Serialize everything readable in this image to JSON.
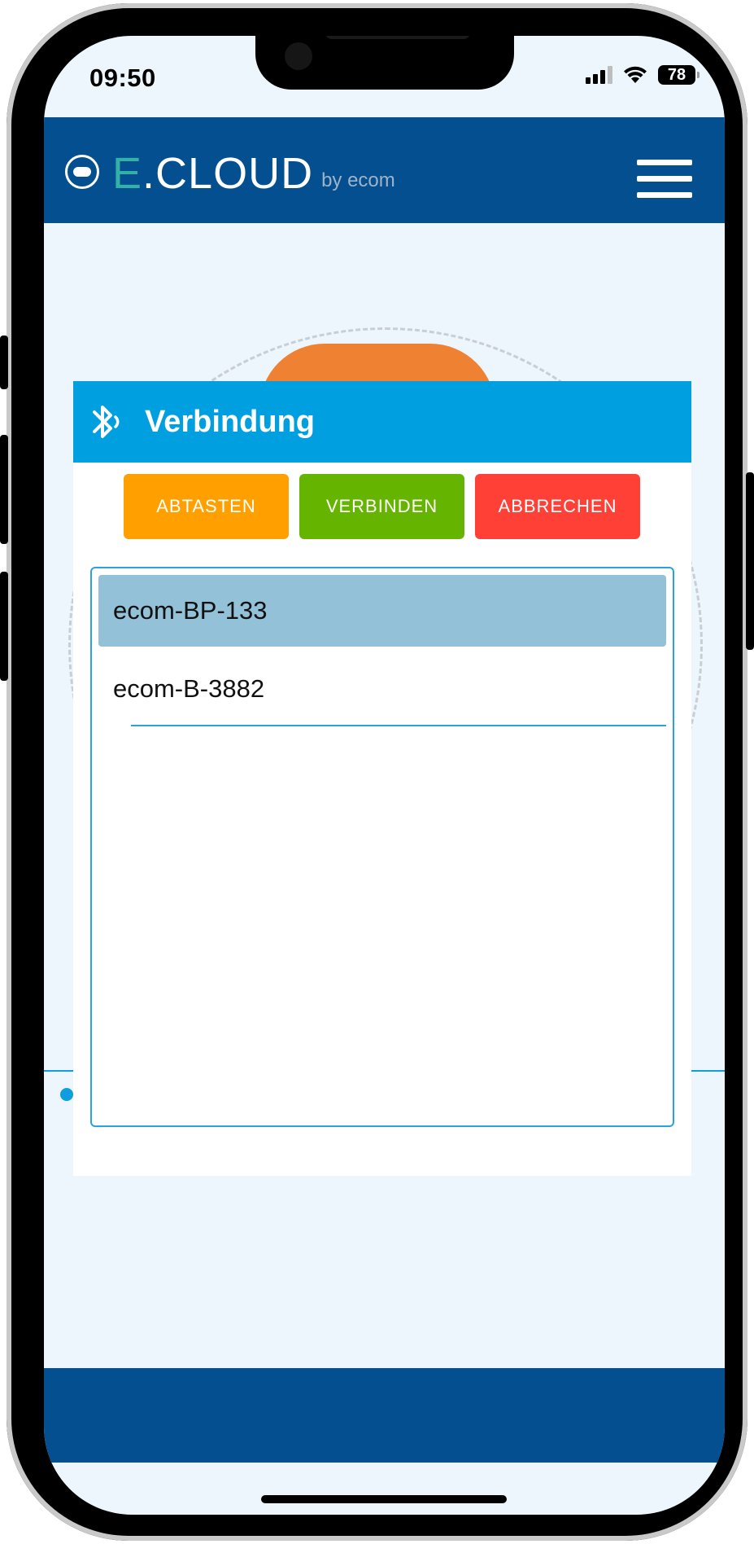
{
  "status_bar": {
    "time": "09:50",
    "battery": "78"
  },
  "header": {
    "logo_main": ".CLOUD",
    "logo_e": "E",
    "logo_by": "by ecom"
  },
  "dialog": {
    "title": "Verbindung",
    "buttons": {
      "scan": "ABTASTEN",
      "connect": "VERBINDEN",
      "cancel": "ABBRECHEN"
    },
    "devices": [
      {
        "name": "ecom-BP-133",
        "selected": true
      },
      {
        "name": "ecom-B-3882",
        "selected": false
      }
    ]
  },
  "colors": {
    "header_bg": "#034f8f",
    "dialog_header_bg": "#009fe0",
    "scan_button": "#ffa000",
    "connect_button": "#65b500",
    "cancel_button": "#ff4037",
    "selected_row": "#92c1d8"
  }
}
